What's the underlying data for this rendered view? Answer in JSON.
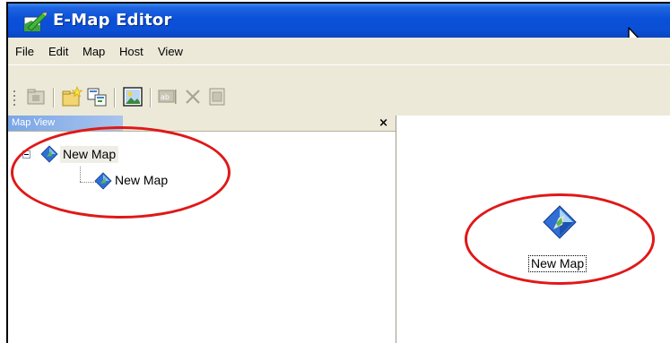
{
  "window": {
    "title": "E-Map Editor"
  },
  "menu": {
    "items": [
      "File",
      "Edit",
      "Map",
      "Host",
      "View"
    ]
  },
  "toolbar": {
    "buttons": [
      "open-folder-icon",
      "new-map-icon",
      "copy-icon",
      "image-icon",
      "rename-icon",
      "delete-icon",
      "properties-icon"
    ]
  },
  "map_view": {
    "title": "Map View",
    "close_label": "×",
    "tree": {
      "root": {
        "label": "New Map",
        "expanded": true,
        "toggle": "minus"
      },
      "child": {
        "label": "New Map"
      }
    }
  },
  "canvas": {
    "object": {
      "label": "New Map",
      "icon": "map-diamond-icon"
    }
  },
  "annotations": {
    "highlight_color": "#e01818"
  }
}
